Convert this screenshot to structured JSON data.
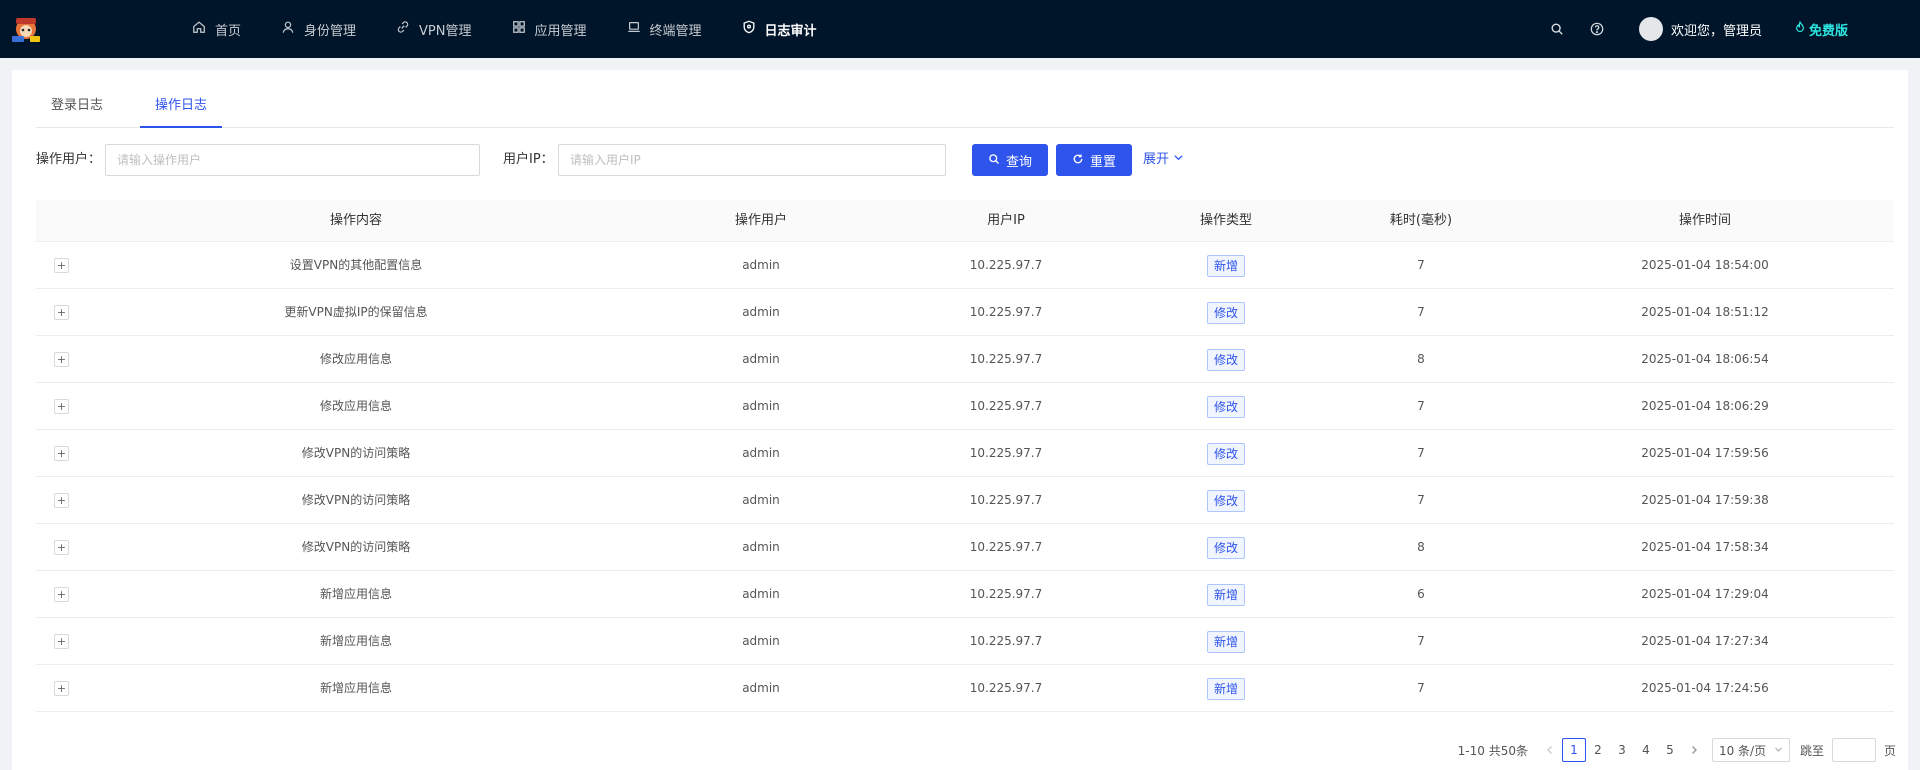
{
  "nav": {
    "items": [
      {
        "label": "首页",
        "icon": "home-icon"
      },
      {
        "label": "身份管理",
        "icon": "user-icon"
      },
      {
        "label": "VPN管理",
        "icon": "link-icon"
      },
      {
        "label": "应用管理",
        "icon": "apps-icon"
      },
      {
        "label": "终端管理",
        "icon": "laptop-icon"
      },
      {
        "label": "日志审计",
        "icon": "shield-icon",
        "active": true
      }
    ],
    "welcome": "欢迎您，管理员",
    "edition": "免费版"
  },
  "tabs": [
    {
      "label": "登录日志",
      "active": false
    },
    {
      "label": "操作日志",
      "active": true
    }
  ],
  "filters": {
    "user_label": "操作用户：",
    "user_placeholder": "请输入操作用户",
    "ip_label": "用户IP：",
    "ip_placeholder": "请输入用户IP",
    "query": "查询",
    "reset": "重置",
    "expand": "展开"
  },
  "table": {
    "headers": [
      "操作内容",
      "操作用户",
      "用户IP",
      "操作类型",
      "耗时(毫秒)",
      "操作时间"
    ],
    "rows": [
      {
        "content": "设置VPN的其他配置信息",
        "user": "admin",
        "ip": "10.225.97.7",
        "type": "新增",
        "duration": "7",
        "time": "2025-01-04 18:54:00"
      },
      {
        "content": "更新VPN虚拟IP的保留信息",
        "user": "admin",
        "ip": "10.225.97.7",
        "type": "修改",
        "duration": "7",
        "time": "2025-01-04 18:51:12"
      },
      {
        "content": "修改应用信息",
        "user": "admin",
        "ip": "10.225.97.7",
        "type": "修改",
        "duration": "8",
        "time": "2025-01-04 18:06:54"
      },
      {
        "content": "修改应用信息",
        "user": "admin",
        "ip": "10.225.97.7",
        "type": "修改",
        "duration": "7",
        "time": "2025-01-04 18:06:29"
      },
      {
        "content": "修改VPN的访问策略",
        "user": "admin",
        "ip": "10.225.97.7",
        "type": "修改",
        "duration": "7",
        "time": "2025-01-04 17:59:56"
      },
      {
        "content": "修改VPN的访问策略",
        "user": "admin",
        "ip": "10.225.97.7",
        "type": "修改",
        "duration": "7",
        "time": "2025-01-04 17:59:38"
      },
      {
        "content": "修改VPN的访问策略",
        "user": "admin",
        "ip": "10.225.97.7",
        "type": "修改",
        "duration": "8",
        "time": "2025-01-04 17:58:34"
      },
      {
        "content": "新增应用信息",
        "user": "admin",
        "ip": "10.225.97.7",
        "type": "新增",
        "duration": "6",
        "time": "2025-01-04 17:29:04"
      },
      {
        "content": "新增应用信息",
        "user": "admin",
        "ip": "10.225.97.7",
        "type": "新增",
        "duration": "7",
        "time": "2025-01-04 17:27:34"
      },
      {
        "content": "新增应用信息",
        "user": "admin",
        "ip": "10.225.97.7",
        "type": "新增",
        "duration": "7",
        "time": "2025-01-04 17:24:56"
      }
    ]
  },
  "pagination": {
    "total": "1-10 共50条",
    "pages": [
      "1",
      "2",
      "3",
      "4",
      "5"
    ],
    "current": "1",
    "page_size": "10 条/页",
    "jump_label": "跳至",
    "jump_suffix": "页"
  },
  "colors": {
    "header_bg": "#001529",
    "primary": "#2f54eb",
    "edition": "#2de5e0"
  }
}
